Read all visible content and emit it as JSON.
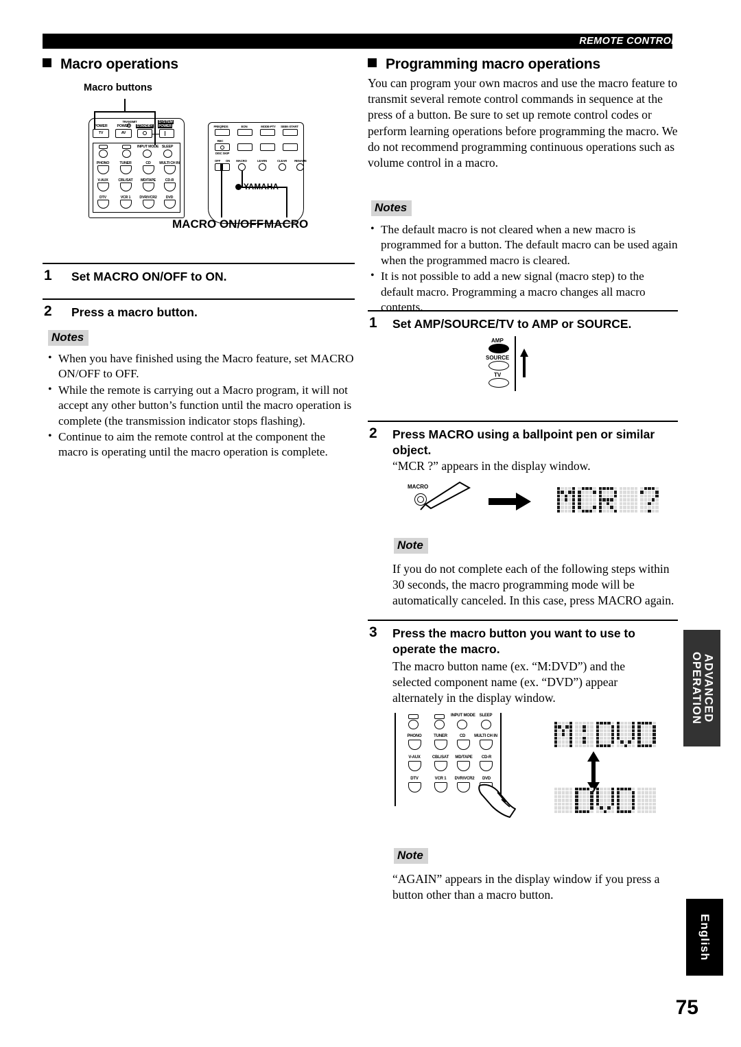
{
  "header": {
    "title": "REMOTE CONTROL FEATURES"
  },
  "page_number": "75",
  "side_tabs": {
    "advanced": "ADVANCED OPERATION",
    "language": "English"
  },
  "left_column": {
    "heading": "Macro operations",
    "diagram": {
      "callout_label": "Macro buttons",
      "macro_onoff_label": "MACRO ON/OFF",
      "macro_label": "MACRO",
      "transmit_label": "TRANSMIT",
      "brand": "YAMAHA",
      "left_remote_buttons": {
        "power_tv_top": "POWER",
        "power_tv": "TV",
        "power_av_top": "POWER",
        "power_av": "AV",
        "standby": "STANDBY",
        "system_power_1": "SYSTEM",
        "system_power_2": "POWER",
        "input_mode": "INPUT MODE",
        "sleep": "SLEEP",
        "row1": [
          "PHONO",
          "TUNER",
          "CD",
          "MULTI CH IN"
        ],
        "row2": [
          "V-AUX",
          "CBL/SAT",
          "MD/TAPE",
          "CD-R"
        ],
        "row3": [
          "DTV",
          "VCR 1",
          "DVR/VCR2",
          "DVD"
        ]
      },
      "right_remote_buttons": {
        "freq_rds": "FREQ/RDS",
        "eon": "EON",
        "mode_pty": "MODE-PTY",
        "seek_start": "SEEK-START",
        "rec": "REC",
        "disc_skip": "DISC SKIP",
        "off": "OFF",
        "on": "ON",
        "macro": "MACRO",
        "learn": "LEARN",
        "clear": "CLEAR",
        "rename": "RENAME"
      }
    },
    "steps": [
      {
        "num": "1",
        "text": "Set MACRO ON/OFF to ON."
      },
      {
        "num": "2",
        "text": "Press a macro button."
      }
    ],
    "notes_tag": "Notes",
    "notes": [
      "When you have finished using the Macro feature, set MACRO ON/OFF to OFF.",
      "While the remote is carrying out a Macro program, it will not accept any other button’s function until the macro operation is complete (the transmission indicator stops flashing).",
      "Continue to aim the remote control at the component the macro is operating until the macro operation is complete."
    ]
  },
  "right_column": {
    "heading": "Programming macro operations",
    "intro": "You can program your own macros and use the macro feature to transmit several remote control commands in sequence at the press of a button. Be sure to set up remote control codes or perform learning operations before programming the macro. We do not recommend programming continuous operations such as volume control in a macro.",
    "notes_tag": "Notes",
    "notes": [
      "The default macro is not cleared when a new macro is programmed for a button. The default macro can be used again when the programmed macro is cleared.",
      "It is not possible to add a new signal (macro step) to the default macro. Programming a macro changes all macro contents."
    ],
    "step1": {
      "num": "1",
      "text": "Set AMP/SOURCE/TV to AMP or SOURCE.",
      "switch": {
        "amp": "AMP",
        "source": "SOURCE",
        "tv": "TV",
        "selected": "AMP"
      }
    },
    "step2": {
      "num": "2",
      "text": "Press MACRO using a ballpoint pen or similar object.",
      "body": "“MCR ?” appears in the display window.",
      "button_label": "MACRO",
      "display": "MCR ?"
    },
    "note1_tag": "Note",
    "note1": "If you do not complete each of the following steps within 30 seconds, the macro programming mode will be automatically canceled. In this case, press MACRO again.",
    "step3": {
      "num": "3",
      "text": "Press the macro button you want to use to operate the macro.",
      "body": "The macro button name (ex. “M:DVD”) and the selected component name (ex. “DVD”) appear alternately in the display window.",
      "display_top": "M:DVD",
      "display_bottom": " DVD ",
      "remote_buttons": {
        "input_mode": "INPUT MODE",
        "sleep": "SLEEP",
        "row1": [
          "PHONO",
          "TUNER",
          "CD",
          "MULTI CH IN"
        ],
        "row2": [
          "V-AUX",
          "CBL/SAT",
          "MD/TAPE",
          "CD-R"
        ],
        "row3": [
          "DTV",
          "VCR 1",
          "DVR/VCR2",
          "DVD"
        ],
        "pressed": "DVD"
      }
    },
    "note2_tag": "Note",
    "note2": "“AGAIN” appears in the display window if you press a button other than a macro button."
  }
}
